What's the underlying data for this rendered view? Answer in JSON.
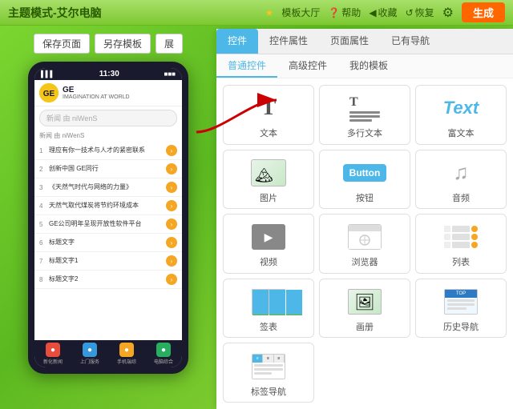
{
  "header": {
    "title": "主题模式-艾尔电脑",
    "nav": {
      "hall": "模板大厅",
      "help": "帮助",
      "collect": "收藏",
      "restore": "恢复",
      "generate": "生成"
    }
  },
  "toolbar": {
    "save_page": "保存页面",
    "save_as": "另存模板",
    "expand": "展"
  },
  "phone": {
    "signal": "▌▌▌",
    "time": "11:30",
    "battery": "■■■",
    "brand": "GE",
    "slogan": "IMAGINATION AT WORLD",
    "search_placeholder": "新闻 由 niWenS",
    "news_label": "新闻 由 niWenS",
    "list_items": [
      {
        "num": "1",
        "text": "理应有你一技术与人才的紧密联系"
      },
      {
        "num": "2",
        "text": "创新中国 GE同行"
      },
      {
        "num": "3",
        "text": "《天然气时代与网络的力量》"
      },
      {
        "num": "4",
        "text": "天然气取代煤炭将节约环境成本"
      },
      {
        "num": "5",
        "text": "GE公司明年呈现开放性软件平台"
      },
      {
        "num": "6",
        "text": "标题文字"
      },
      {
        "num": "7",
        "text": "标题文字1"
      },
      {
        "num": "8",
        "text": "标题文字2"
      }
    ],
    "bottom_nav": [
      {
        "label": "新化新闻",
        "color": "#e74c3c"
      },
      {
        "label": "上门服务",
        "color": "#3498db"
      },
      {
        "label": "手机端综",
        "color": "#f5a623"
      },
      {
        "label": "电脑综合",
        "color": "#27ae60"
      }
    ]
  },
  "right_panel": {
    "tabs": [
      {
        "label": "控件",
        "active": true
      },
      {
        "label": "控件属性"
      },
      {
        "label": "页面属性"
      },
      {
        "label": "已有导航"
      }
    ],
    "subtabs": [
      {
        "label": "普通控件",
        "active": true
      },
      {
        "label": "高级控件"
      },
      {
        "label": "我的模板"
      }
    ],
    "controls": [
      {
        "label": "文本",
        "icon": "text"
      },
      {
        "label": "多行文本",
        "icon": "multitext"
      },
      {
        "label": "富文本",
        "icon": "richtext"
      },
      {
        "label": "图片",
        "icon": "image"
      },
      {
        "label": "按钮",
        "icon": "button"
      },
      {
        "label": "音频",
        "icon": "audio"
      },
      {
        "label": "视频",
        "icon": "video"
      },
      {
        "label": "浏览器",
        "icon": "browser"
      },
      {
        "label": "列表",
        "icon": "list"
      },
      {
        "label": "签表",
        "icon": "table"
      },
      {
        "label": "画册",
        "icon": "gallery"
      },
      {
        "label": "历史导航",
        "icon": "history"
      },
      {
        "label": "标签导航",
        "icon": "tabs"
      }
    ]
  },
  "colors": {
    "accent": "#4db8e8",
    "orange": "#f5a623",
    "green": "#7dd832",
    "red": "#e74c3c",
    "generate_btn": "#ff6600"
  }
}
